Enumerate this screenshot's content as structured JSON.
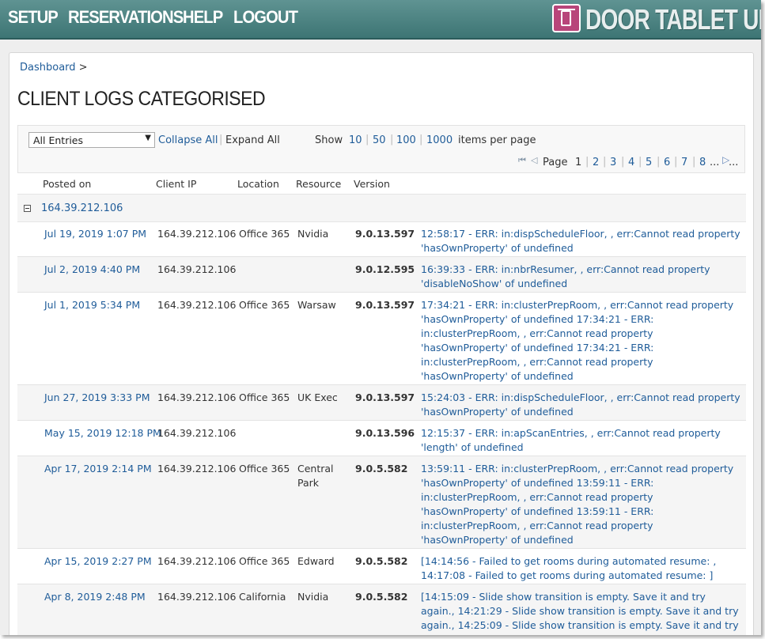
{
  "nav": {
    "items": [
      "SETUP",
      "RESERVATIONS",
      "HELP",
      "LOGOUT"
    ],
    "brand": "DOOR TABLET UI"
  },
  "breadcrumb": {
    "link": "Dashboard",
    "separator": ">"
  },
  "page_title": "CLIENT LOGS CATEGORISED",
  "toolbar": {
    "filter_value": "All Entries",
    "collapse_all": "Collapse All",
    "expand_all": "Expand All",
    "show_label": "Show",
    "per_page_options": [
      "10",
      "50",
      "100",
      "1000"
    ],
    "items_per_page": "items per page",
    "page_label": "Page",
    "pages": [
      "1",
      "2",
      "3",
      "4",
      "5",
      "6",
      "7",
      "8"
    ],
    "ellipsis": "..."
  },
  "columns": [
    "Posted on",
    "Client IP",
    "Location",
    "Resource",
    "Version"
  ],
  "group": {
    "label": "164.39.212.106"
  },
  "rows": [
    {
      "date": "Jul 19, 2019 1:07 PM",
      "ip": "164.39.212.106",
      "location": "Office 365",
      "resource": "Nvidia",
      "version": "9.0.13.597",
      "message": "12:58:17 - ERR: in:dispScheduleFloor, , err:Cannot read property 'hasOwnProperty' of undefined"
    },
    {
      "date": "Jul 2, 2019 4:40 PM",
      "ip": "164.39.212.106",
      "location": "",
      "resource": "",
      "version": "9.0.12.595",
      "message": "16:39:33 - ERR: in:nbrResumer, , err:Cannot read property 'disableNoShow' of undefined"
    },
    {
      "date": "Jul 1, 2019 5:34 PM",
      "ip": "164.39.212.106",
      "location": "Office 365",
      "resource": "Warsaw",
      "version": "9.0.13.597",
      "message": "17:34:21 - ERR: in:clusterPrepRoom, , err:Cannot read property 'hasOwnProperty' of undefined 17:34:21 - ERR: in:clusterPrepRoom, , err:Cannot read property 'hasOwnProperty' of undefined 17:34:21 - ERR: in:clusterPrepRoom, , err:Cannot read property 'hasOwnProperty' of undefined"
    },
    {
      "date": "Jun 27, 2019 3:33 PM",
      "ip": "164.39.212.106",
      "location": "Office 365",
      "resource": "UK Exec",
      "version": "9.0.13.597",
      "message": "15:24:03 - ERR: in:dispScheduleFloor, , err:Cannot read property 'hasOwnProperty' of undefined"
    },
    {
      "date": "May 15, 2019 12:18 PM",
      "ip": "164.39.212.106",
      "location": "",
      "resource": "",
      "version": "9.0.13.596",
      "message": "12:15:37 - ERR: in:apScanEntries, , err:Cannot read property 'length' of undefined"
    },
    {
      "date": "Apr 17, 2019 2:14 PM",
      "ip": "164.39.212.106",
      "location": "Office 365",
      "resource": "Central Park",
      "version": "9.0.5.582",
      "message": "13:59:11 - ERR: in:clusterPrepRoom, , err:Cannot read property 'hasOwnProperty' of undefined 13:59:11 - ERR: in:clusterPrepRoom, , err:Cannot read property 'hasOwnProperty' of undefined 13:59:11 - ERR: in:clusterPrepRoom, , err:Cannot read property 'hasOwnProperty' of undefined"
    },
    {
      "date": "Apr 15, 2019 2:27 PM",
      "ip": "164.39.212.106",
      "location": "Office 365",
      "resource": "Edward",
      "version": "9.0.5.582",
      "message": "[14:14:56 - Failed to get rooms during automated resume: , 14:17:08 - Failed to get rooms during automated resume: ]"
    },
    {
      "date": "Apr 8, 2019 2:48 PM",
      "ip": "164.39.212.106",
      "location": "California",
      "resource": "Nvidia",
      "version": "9.0.5.582",
      "message": "[14:15:09 - Slide show transition is empty. Save it and try again., 14:21:29 - Slide show transition is empty. Save it and try again., 14:25:09 - Slide show transition is empty. Save it and try"
    }
  ]
}
